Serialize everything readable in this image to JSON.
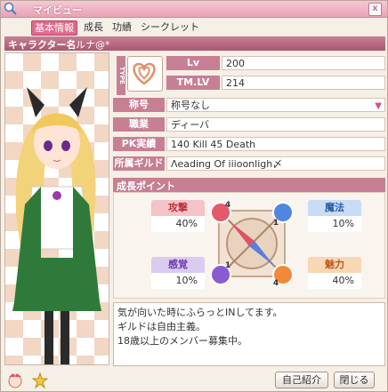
{
  "window": {
    "title": "マイビュー",
    "close_label": "x"
  },
  "tabs": [
    {
      "label": "基本情報"
    },
    {
      "label": "成長"
    },
    {
      "label": "功績"
    },
    {
      "label": "シークレット"
    }
  ],
  "character": {
    "name_label": "キャラクター名",
    "name": "ルナ@*"
  },
  "type": {
    "label": "TYPE",
    "icon": "heart-spiral-icon"
  },
  "fields": {
    "lv": {
      "label": "Lv",
      "value": "200"
    },
    "tmlv": {
      "label": "TM.LV",
      "value": "214"
    },
    "title": {
      "label": "称号",
      "value": "称号なし"
    },
    "job": {
      "label": "職業",
      "value": "ディーバ"
    },
    "pk": {
      "label": "PK実績",
      "value": "140 Kill  45 Death"
    },
    "guild": {
      "label": "所属ギルド",
      "value": "Λeading Of iiioonligh〆"
    }
  },
  "growth": {
    "header": "成長ポイント",
    "stats": {
      "attack": {
        "label": "攻撃",
        "value": "40%",
        "color": "#f3c3c8"
      },
      "magic": {
        "label": "魔法",
        "value": "10%",
        "color": "#c8dcf5"
      },
      "sense": {
        "label": "感覚",
        "value": "10%",
        "color": "#d9ccf0"
      },
      "charm": {
        "label": "魅力",
        "value": "40%",
        "color": "#f7d7b4"
      }
    },
    "badges": {
      "tl": "4",
      "tr": "1",
      "bl": "1",
      "br": "4"
    }
  },
  "intro": {
    "lines": [
      "気が向いた時にふらっとINしてます。",
      "ギルドは自由主義。",
      "18歳以上のメンバー募集中。"
    ]
  },
  "buttons": {
    "intro": "自己紹介",
    "close": "閉じる"
  }
}
